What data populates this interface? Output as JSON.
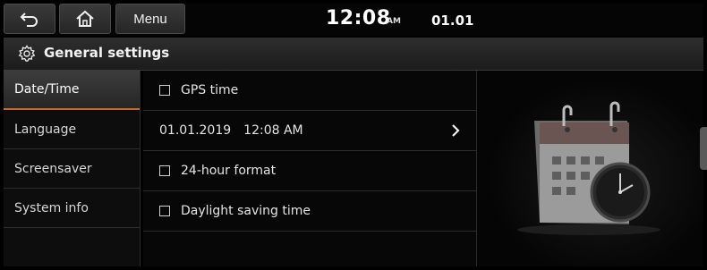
{
  "statusbar": {
    "back_icon": "back-arrow-icon",
    "home_icon": "home-icon",
    "menu_label": "Menu",
    "time": "12:08",
    "ampm": "AM",
    "date": "01.01"
  },
  "titlebar": {
    "icon": "gear-icon",
    "title": "General settings"
  },
  "sidebar": {
    "items": [
      {
        "label": "Date/Time",
        "active": true
      },
      {
        "label": "Language",
        "active": false
      },
      {
        "label": "Screensaver",
        "active": false
      },
      {
        "label": "System info",
        "active": false
      }
    ]
  },
  "main": {
    "rows": [
      {
        "type": "checkbox",
        "label": "GPS time",
        "checked": false
      },
      {
        "type": "link",
        "date": "01.01.2019",
        "time": "12:08 AM"
      },
      {
        "type": "checkbox",
        "label": "24-hour format",
        "checked": false
      },
      {
        "type": "checkbox",
        "label": "Daylight saving time",
        "checked": false
      }
    ]
  },
  "illustration": {
    "icon": "calendar-clock-icon"
  },
  "colors": {
    "accent": "#c66a2a",
    "background": "#000000"
  }
}
